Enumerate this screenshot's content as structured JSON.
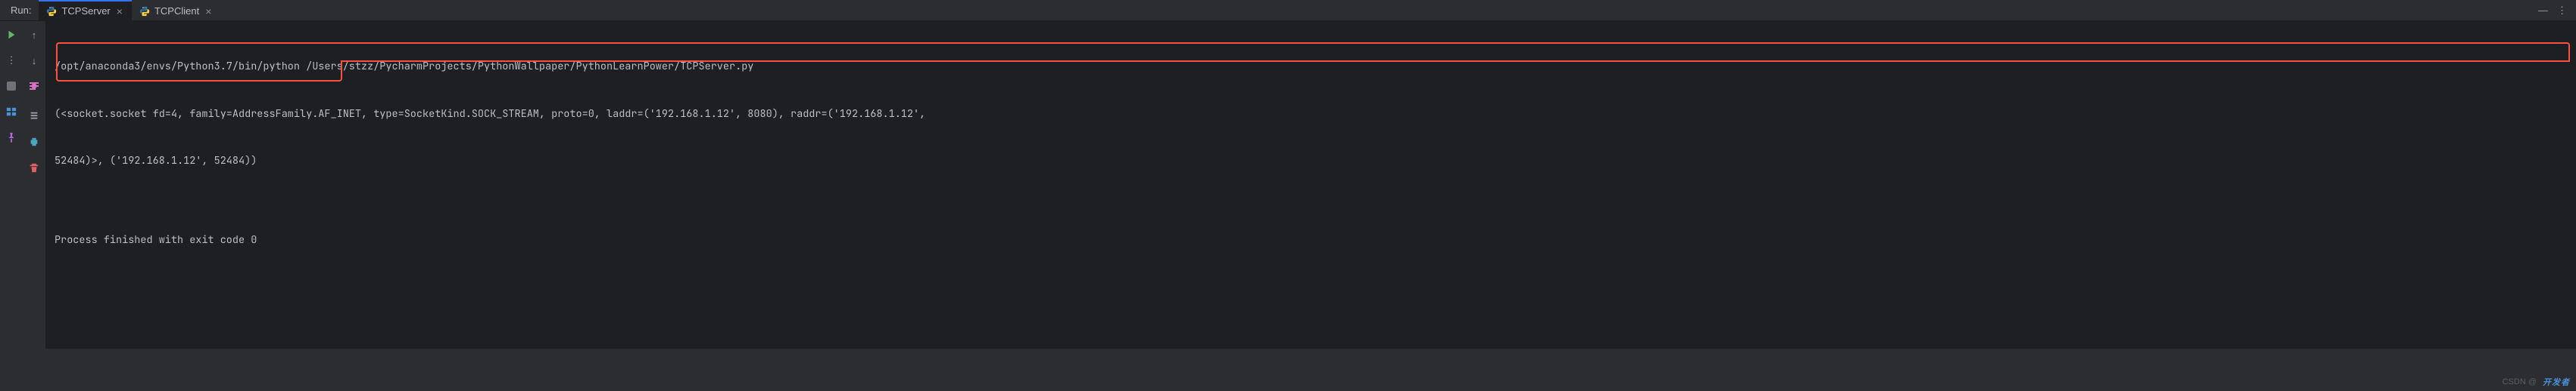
{
  "header": {
    "run_label": "Run:",
    "tabs": [
      {
        "label": "TCPServer",
        "active": true
      },
      {
        "label": "TCPClient",
        "active": false
      }
    ]
  },
  "console": {
    "line1": "/opt/anaconda3/envs/Python3.7/bin/python /Users/stzz/PycharmProjects/PythonWallpaper/PythonLearnPower/TCPServer.py",
    "line2": "(<socket.socket fd=4, family=AddressFamily.AF_INET, type=SocketKind.SOCK_STREAM, proto=0, laddr=('192.168.1.12', 8080), raddr=('192.168.1.12',",
    "line3": "52484)>, ('192.168.1.12', 52484))",
    "line4": "",
    "line5": "Process finished with exit code 0"
  },
  "watermark": {
    "csdn": "CSDN @",
    "brand": "开发者"
  }
}
